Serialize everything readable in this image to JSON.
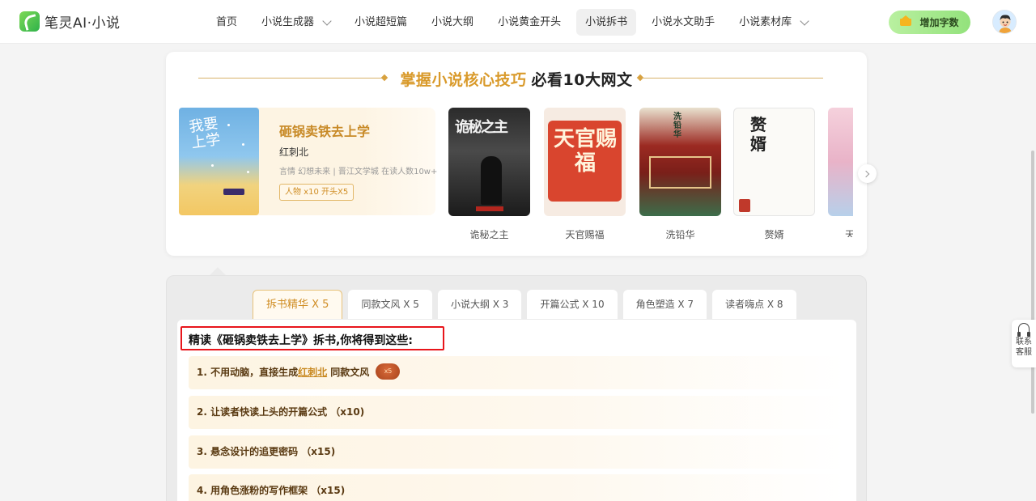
{
  "app": {
    "logo_text": "笔灵AI·小说",
    "icon": "quill-leaf-icon"
  },
  "nav": {
    "items": [
      {
        "label": "首页",
        "dropdown": false,
        "active": false
      },
      {
        "label": "小说生成器",
        "dropdown": true,
        "active": false
      },
      {
        "label": "小说超短篇",
        "dropdown": false,
        "active": false
      },
      {
        "label": "小说大纲",
        "dropdown": false,
        "active": false
      },
      {
        "label": "小说黄金开头",
        "dropdown": false,
        "active": false
      },
      {
        "label": "小说拆书",
        "dropdown": false,
        "active": true
      },
      {
        "label": "小说水文助手",
        "dropdown": false,
        "active": false
      },
      {
        "label": "小说素材库",
        "dropdown": true,
        "active": false
      }
    ],
    "add_words_label": "增加字数"
  },
  "banner": {
    "title_highlight": "掌握小说核心技巧",
    "title_rest": "必看10大网文",
    "featured": {
      "title": "砸锅卖铁去上学",
      "cover_text": "我要上学",
      "author": "红刺北",
      "meta": "言情 幻想未来 | 晋江文学城 在读人数10w+",
      "tag": "人物 x10 开头X5"
    },
    "books": [
      {
        "name": "诡秘之主",
        "cover_text": "诡秘之主"
      },
      {
        "name": "天官赐福",
        "cover_text": "天官赐福"
      },
      {
        "name": "洗铅华",
        "cover_text": "洗铅华"
      },
      {
        "name": "赘婿",
        "cover_text": "赘婿"
      },
      {
        "name": "天"
      }
    ]
  },
  "tabs": [
    {
      "label": "拆书精华 X 5",
      "active": true
    },
    {
      "label": "同款文风 X 5",
      "active": false
    },
    {
      "label": "小说大纲 X 3",
      "active": false
    },
    {
      "label": "开篇公式 X 10",
      "active": false
    },
    {
      "label": "角色塑造 X 7",
      "active": false
    },
    {
      "label": "读者嗨点 X 8",
      "active": false
    }
  ],
  "content": {
    "heading": "精读《砸锅卖铁去上学》拆书,你将得到这些:",
    "items": [
      {
        "prefix": "1. 不用动脑，直接生成",
        "highlight": "红刺北",
        "suffix": " 同款文风",
        "badge": "x5"
      },
      {
        "text": "2. 让读者快读上头的开篇公式 （x10)"
      },
      {
        "text": "3. 悬念设计的追更密码 （x15)"
      },
      {
        "text": "4. 用角色涨粉的写作框架 （x15)"
      }
    ]
  },
  "service": {
    "label": "联系客服"
  }
}
